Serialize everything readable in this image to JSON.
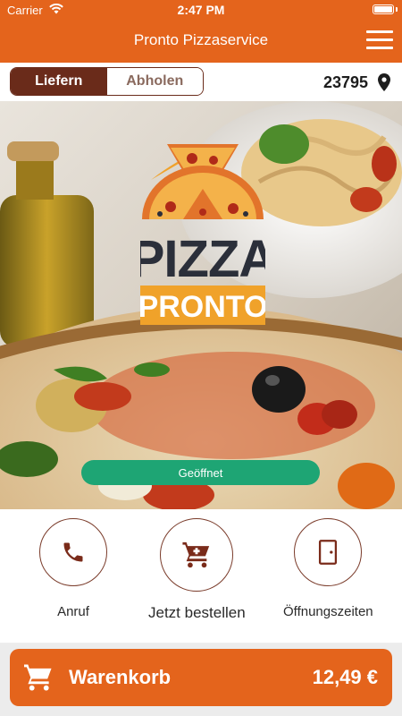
{
  "status_bar": {
    "carrier": "Carrier",
    "time": "2:47 PM"
  },
  "nav": {
    "title": "Pronto Pizzaservice",
    "menu_icon": "hamburger-menu-icon"
  },
  "order_mode": {
    "options": [
      "Liefern",
      "Abholen"
    ],
    "selected": "Liefern"
  },
  "location": {
    "zip": "23795",
    "icon": "map-pin-icon"
  },
  "hero": {
    "logo": {
      "word1": "PIZZA",
      "word2": "PRONTO"
    },
    "status_label": "Geöffnet"
  },
  "actions": [
    {
      "label": "Anruf",
      "icon": "phone-icon"
    },
    {
      "label": "Jetzt bestellen",
      "icon": "shopping-cart-icon"
    },
    {
      "label": "Öffnungszeiten",
      "icon": "door-icon"
    }
  ],
  "cart": {
    "label": "Warenkorb",
    "total": "12,49 €",
    "icon": "shopping-cart-icon"
  },
  "colors": {
    "brand": "#e4641c",
    "dark_brown": "#6a2b1a",
    "open_green": "#1ea574",
    "logo_dark": "#2b2f3a",
    "logo_yellow": "#f0a22a"
  }
}
